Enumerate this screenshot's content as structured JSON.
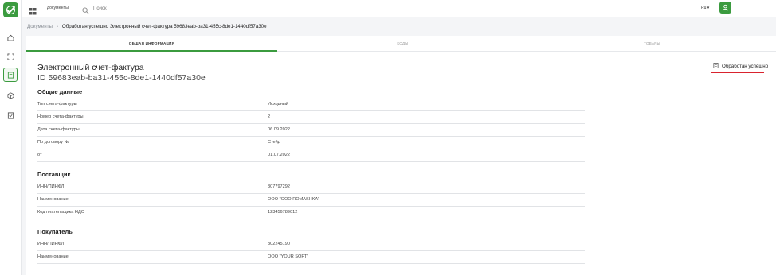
{
  "topbar": {
    "docs_label": "документы",
    "search_placeholder": "Поиск",
    "lang": "Ru"
  },
  "breadcrumb": {
    "root": "Документы",
    "current": "Обработан успешно Электронный счет-фактура 59683eab-ba31-455c-8de1-1440df57a30e"
  },
  "tabs": [
    {
      "label": "общая информация",
      "active": true
    },
    {
      "label": "коды",
      "active": false
    },
    {
      "label": "товары",
      "active": false
    }
  ],
  "document": {
    "title": "Электронный счет-фактура",
    "id_line": "ID 59683eab-ba31-455c-8de1-1440df57a30e",
    "status": "Обработан успешно"
  },
  "sections": {
    "general": {
      "title": "Общие данные",
      "rows": [
        {
          "label": "Тип счета-фактуры",
          "value": "Исходный"
        },
        {
          "label": "Номер счета-фактуры",
          "value": "2"
        },
        {
          "label": "Дата счета-фактуры",
          "value": "06.09.2022"
        },
        {
          "label": "По договору №",
          "value": "Стейд"
        },
        {
          "label": "от",
          "value": "01.07.2022"
        }
      ]
    },
    "supplier": {
      "title": "Поставщик",
      "rows": [
        {
          "label": "ИНН/ПИНФЛ",
          "value": "307797292"
        },
        {
          "label": "Наименование",
          "value": "ООО \"ООО ROMASHKA\""
        },
        {
          "label": "Код плательщика НДС",
          "value": "123456789012"
        }
      ]
    },
    "buyer": {
      "title": "Покупатель",
      "rows": [
        {
          "label": "ИНН/ПИНФЛ",
          "value": "302245190"
        },
        {
          "label": "Наименование",
          "value": "ООО \"YOUR SOFT\""
        }
      ]
    }
  },
  "colors": {
    "brand": "#3b9b3f",
    "status_underline": "#d9232e"
  },
  "icons": [
    "logo-icon",
    "home-icon",
    "scan-icon",
    "documents-icon",
    "box-icon",
    "checklist-icon",
    "apps-grid-icon",
    "search-icon",
    "chevron-down-icon",
    "user-icon",
    "chevron-right-icon",
    "document-status-icon"
  ]
}
